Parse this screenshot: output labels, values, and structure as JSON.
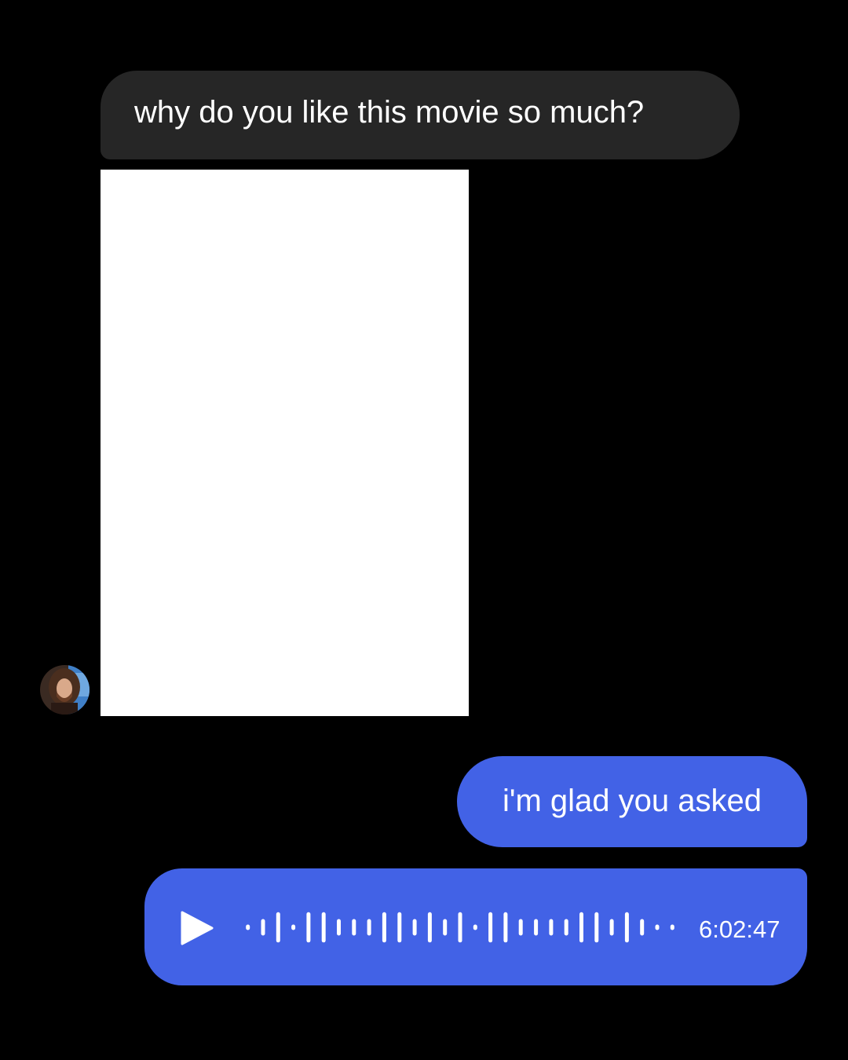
{
  "thread": {
    "incoming_message": {
      "text": "why do you like this movie so much?"
    },
    "image_attachment": {
      "background": "#ffffff"
    },
    "avatar": {
      "icon": "person-avatar-icon"
    },
    "outgoing_message": {
      "text": "i'm glad you asked"
    },
    "voice_message": {
      "duration": "6:02:47",
      "play_icon": "play-icon",
      "waveform_levels": [
        0.1,
        0.3,
        0.55,
        0.1,
        0.55,
        0.55,
        0.3,
        0.3,
        0.3,
        0.55,
        0.55,
        0.3,
        0.55,
        0.3,
        0.55,
        0.1,
        0.55,
        0.55,
        0.3,
        0.3,
        0.3,
        0.3,
        0.55,
        0.55,
        0.3,
        0.55,
        0.3,
        0.1,
        0.1
      ]
    }
  },
  "colors": {
    "background": "#000000",
    "incoming_bubble": "#262626",
    "outgoing_bubble": "#4262e6",
    "text": "#ffffff"
  }
}
